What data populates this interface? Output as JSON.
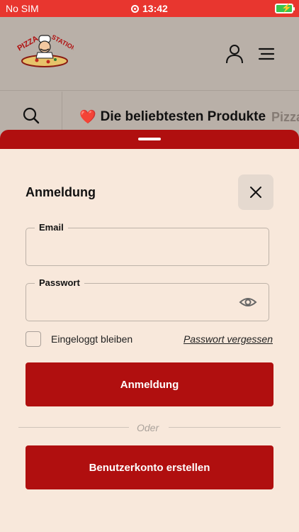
{
  "status_bar": {
    "carrier": "No SIM",
    "time": "13:42"
  },
  "header": {
    "logo_text": "PIZZA STATION",
    "logo_icon": "pizza-chef-logo",
    "user_icon": "user-icon",
    "menu_icon": "hamburger-menu-icon"
  },
  "category_bar": {
    "search_icon": "search-icon",
    "active_emoji": "❤️",
    "active_label": "Die beliebtesten Produkte",
    "next_label": "Pizza"
  },
  "login_sheet": {
    "title": "Anmeldung",
    "close_icon": "close-icon",
    "email_label": "Email",
    "email_value": "",
    "password_label": "Passwort",
    "password_value": "",
    "eye_icon": "eye-icon",
    "remember_label": "Eingeloggt bleiben",
    "remember_checked": false,
    "forgot_label": "Passwort vergessen",
    "login_button": "Anmeldung",
    "divider_text": "Oder",
    "create_account_button": "Benutzerkonto erstellen"
  },
  "colors": {
    "status_bar": "#e8362f",
    "header_bg": "#b9b0a8",
    "brand_red": "#b00f0f",
    "sheet_bg": "#f8e8db"
  }
}
